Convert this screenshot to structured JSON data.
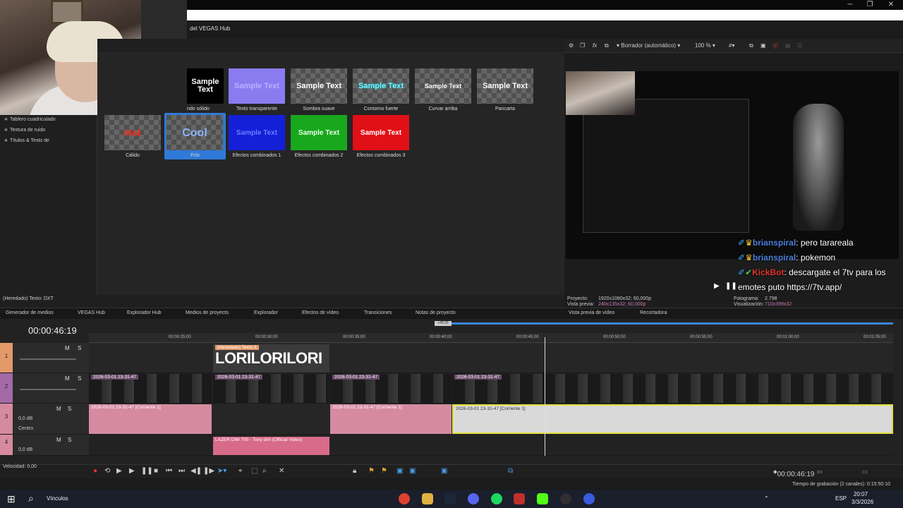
{
  "window": {
    "title": "del VEGAS Hub",
    "controls": [
      "─",
      "❐",
      "✕"
    ]
  },
  "left_panel": {
    "items": [
      "Tablero cuadriculado",
      "Textura de ruido",
      "Títulos & Texto de"
    ]
  },
  "presets": [
    {
      "thumb": "Sample Text",
      "caption": "ndo sólido"
    },
    {
      "thumb": "Sample Text",
      "caption": "Texto transparente"
    },
    {
      "thumb": "Sample Text",
      "caption": "Sombra suave"
    },
    {
      "thumb": "Sample Text",
      "caption": "Contorno fuerte"
    },
    {
      "thumb": "Sample Text",
      "caption": "Curvar arriba"
    },
    {
      "thumb": "Sample Text",
      "caption": "Pancarta"
    },
    {
      "thumb": "Hot",
      "caption": "Cálido"
    },
    {
      "thumb": "Cool",
      "caption": "Frío"
    },
    {
      "thumb": "Sample Text",
      "caption": "Efectos combinados 1"
    },
    {
      "thumb": "Sample Text",
      "caption": "Efectos combinados 2"
    },
    {
      "thumb": "Sample Text",
      "caption": "Efectos combinados 3"
    }
  ],
  "status_fx": "(Heredado) Texto: DXT",
  "tabs": [
    "Generador de medios",
    "VEGAS Hub",
    "Explorador Hub",
    "Medios de proyecto",
    "Explorador",
    "Efectos de vídeo",
    "Transiciones",
    "Notas de proyecto",
    "Vista previa de vídeo",
    "Recortadora"
  ],
  "preview": {
    "mode": "Borrador (automático)",
    "zoom": "100 %",
    "proyecto_label": "Proyecto:",
    "proyecto_value": "1920x1080x32; 60,000p",
    "vista_label": "Vista previa:",
    "vista_value": "240x135x32; 60,000p",
    "fotograma_label": "Fotograma:",
    "fotograma_value": "2.798",
    "visual_label": "Visualización:",
    "visual_value": "710x399x32"
  },
  "chat": [
    {
      "user": "brianspiral",
      "msg": ": pero tarareala"
    },
    {
      "user": "brianspiral",
      "msg": ": pokemon"
    },
    {
      "user": "KickBot",
      "msg": ": descargate el 7tv para los"
    },
    {
      "user": "",
      "msg": "emotes puto https://7tv.app/"
    }
  ],
  "timeline": {
    "timecode": "00:00:46:19",
    "region_label": "+45:25",
    "ruler": [
      "00:00:25;00",
      "00:00:30;00",
      "00:00:35;00",
      "00:00:40;00",
      "00:00:45;00",
      "00:00:50;00",
      "00:00:55;00",
      "00:01:00;00",
      "00:01:05;00"
    ],
    "tracks": [
      {
        "num": "1",
        "m": "M",
        "s": "S"
      },
      {
        "num": "2",
        "m": "M",
        "s": "S"
      },
      {
        "num": "3",
        "m": "M",
        "s": "S",
        "db": "0,0 dB",
        "pan": "Centro"
      },
      {
        "num": "4",
        "m": "M",
        "s": "S",
        "db": "0,0 dB"
      }
    ],
    "text_clip_label": "(Heredado) Texto 3",
    "text_clip_text": "LORILORILORI",
    "video_clip": "2026-03-01 23-31-47",
    "audio_clip": "2026-03-01 23-31-47 [Corriente 1]",
    "music_clip": "LAZER DIM 700 - Tony dim (Official Video)"
  },
  "transport": {
    "speed": "Velocidad: 0,00",
    "end_time": "00:00:46:19"
  },
  "status": {
    "recording": "Tiempo de grabación (2 canales): 0:15:50:10"
  },
  "taskbar": {
    "search": "Vínculos",
    "lang": "ESP",
    "time": "20:07",
    "date": "3/3/2026"
  }
}
